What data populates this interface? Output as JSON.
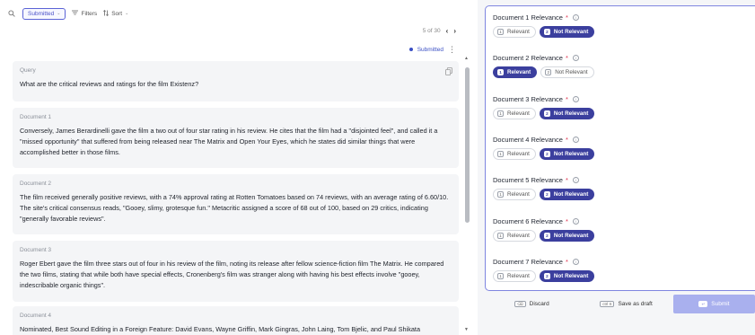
{
  "toolbar": {
    "status_filter": "Submitted",
    "filters_label": "Filters",
    "sort_label": "Sort"
  },
  "pager": {
    "text": "5 of 30"
  },
  "task_status": "Submitted",
  "query": {
    "label": "Query",
    "text": "What are the critical reviews and ratings for the film Existenz?"
  },
  "documents": [
    {
      "label": "Document 1",
      "text": "Conversely, James Berardinelli gave the film a two out of four star rating in his review. He cites that the film had a \"disjointed feel\", and called it a \"missed opportunity\" that suffered from being released near The Matrix and Open Your Eyes, which he states did similar things that were accomplished better in those films."
    },
    {
      "label": "Document 2",
      "text": "The film received generally positive reviews, with a 74% approval rating at Rotten Tomatoes based on 74 reviews, with an average rating of 6.60/10. The site's critical consensus reads, \"Gooey, slimy, grotesque fun.\" Metacritic assigned a score of 68 out of 100, based on 29 critics, indicating \"generally favorable reviews\"."
    },
    {
      "label": "Document 3",
      "text": "Roger Ebert gave the film three stars out of four in his review of the film, noting its release after fellow science-fiction film The Matrix. He compared the two films, stating that while both have special effects, Cronenberg's film was stranger along with having his best effects involve \"gooey, indescribable organic things\"."
    },
    {
      "label": "Document 4",
      "text": "Nominated, Best Sound Editing in a Foreign Feature: David Evans, Wayne Griffin, Mark Gingras, John Laing, Tom Bjelic, and Paul Shikata"
    }
  ],
  "relevance": {
    "option_relevant": "Relevant",
    "option_not_relevant": "Not Relevant",
    "key_relevant": "1",
    "key_not_relevant": "2",
    "required_mark": "*",
    "questions": [
      {
        "title": "Document 1 Relevance",
        "selected": "not_relevant"
      },
      {
        "title": "Document 2 Relevance",
        "selected": "relevant"
      },
      {
        "title": "Document 3 Relevance",
        "selected": "not_relevant"
      },
      {
        "title": "Document 4 Relevance",
        "selected": "not_relevant"
      },
      {
        "title": "Document 5 Relevance",
        "selected": "not_relevant"
      },
      {
        "title": "Document 6 Relevance",
        "selected": "not_relevant"
      },
      {
        "title": "Document 7 Relevance",
        "selected": "not_relevant"
      }
    ]
  },
  "actions": {
    "discard_key": "⌫",
    "discard_label": "Discard",
    "draft_key": "ctrl S",
    "draft_label": "Save as draft",
    "submit_key": "↵",
    "submit_label": "Submit"
  },
  "colors": {
    "accent": "#3b3f9e",
    "form_border": "#7f86e0",
    "submit_bg": "#a9b0ee",
    "required": "#e0334f"
  }
}
